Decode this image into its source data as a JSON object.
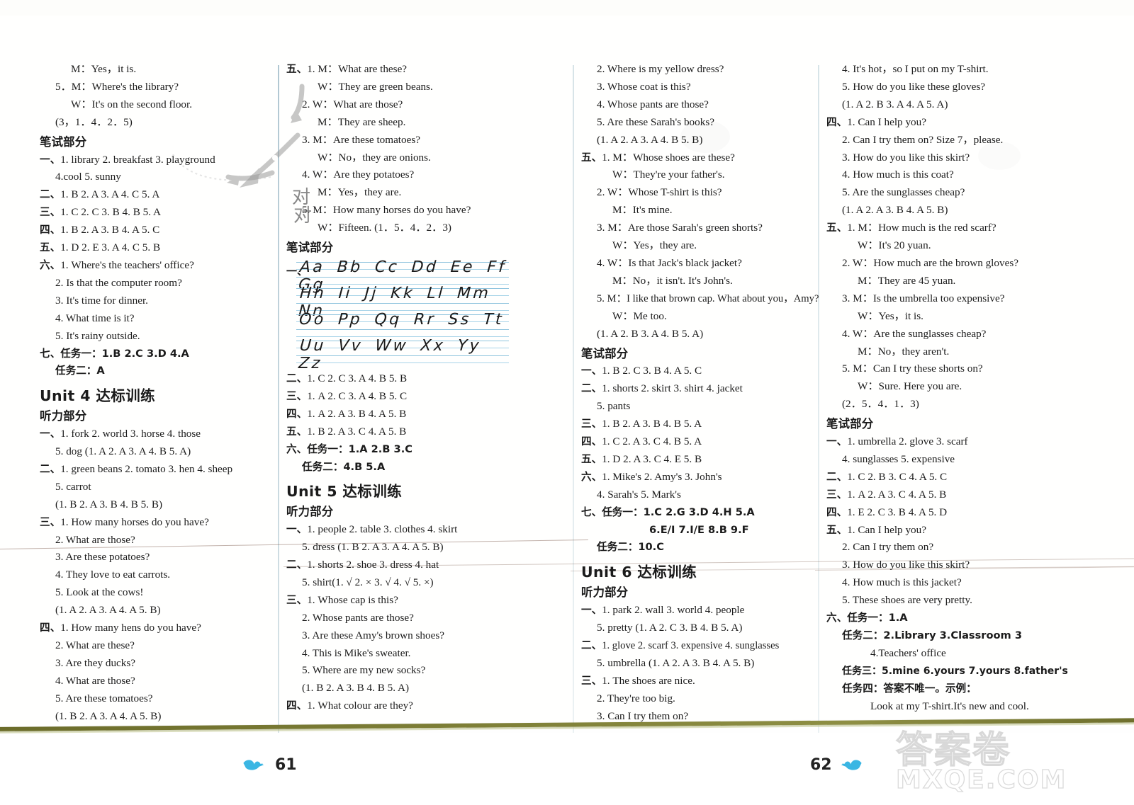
{
  "page": {
    "left_page_number": "61",
    "right_page_number": "62",
    "watermark_cn": "答案卷",
    "watermark_en": "MXQE.COM"
  },
  "labels": {
    "listening_section": "听力部分",
    "written_section": "笔试部分",
    "unit4_title": "Unit 4 达标训练",
    "unit5_title": "Unit 5 达标训练",
    "unit6_title": "Unit 6 达标训练"
  },
  "annotations": {
    "check_mark_1": "对",
    "check_mark_2": "对"
  },
  "col1": {
    "l01": "M：Yes，it is.",
    "l02": "5．M：Where's the library?",
    "l03": "W：It's on the second floor.",
    "l04": "(3，1．4．2．5)",
    "l05": "笔试部分",
    "l06_num": "一、",
    "l06": "1. library   2. breakfast   3. playground",
    "l07": "4.cool   5. sunny",
    "l08_num": "二、",
    "l08": "1. B   2. A   3. A   4. C   5. A",
    "l09_num": "三、",
    "l09": "1. C   2. C   3. B   4. B   5. A",
    "l10_num": "四、",
    "l10": "1. B   2. A   3. B   4. A   5. C",
    "l11_num": "五、",
    "l11": "1. D   2. E   3. A   4. C   5. B",
    "l12_num": "六、",
    "l12": "1. Where's the teachers' office?",
    "l13": "2. Is that the computer room?",
    "l14": "3. It's time for dinner.",
    "l15": "4. What time is it?",
    "l16": "5. It's rainy outside.",
    "l17_num": "七、",
    "l17": "任务一：1.B   2.C   3.D   4.A",
    "l18": "任务二：A",
    "unit_title": "Unit 4 达标训练",
    "listening": "听力部分",
    "l19_num": "一、",
    "l19": "1. fork   2. world   3. horse   4. those",
    "l20": "5. dog   (1. A   2. A   3. A   4. B   5. A)",
    "l21_num": "二、",
    "l21": "1. green beans   2. tomato   3. hen   4. sheep",
    "l22": "5. carrot",
    "l23": "(1. B   2. A   3. B   4. B   5. B)",
    "l24_num": "三、",
    "l24": "1. How many horses do you have?",
    "l25": "2. What are those?",
    "l26": "3. Are these potatoes?",
    "l27": "4. They love to eat carrots.",
    "l28": "5. Look at the cows!",
    "l29": "(1. A   2. A   3. A   4. A   5. B)",
    "l30_num": "四、",
    "l30": "1. How many hens do you have?",
    "l31": "2. What are these?",
    "l32": "3. Are they ducks?",
    "l33": "4. What are those?",
    "l34": "5. Are these tomatoes?",
    "l35": "(1. B   2. A   3. A   4. A   5. B)"
  },
  "col2": {
    "l01_num": "五、",
    "l01": "1. M：What are these?",
    "l02": "W：They are green beans.",
    "l03": "2. W：What are those?",
    "l04": "M：They are sheep.",
    "l05": "3. M：Are these tomatoes?",
    "l06": "W：No，they are onions.",
    "l07": "4. W：Are they potatoes?",
    "l08": "M：Yes，they are.",
    "l09": "5. M：How many horses do you have?",
    "l10": "W：Fifteen.   (1．5．4．2．3)",
    "l11": "笔试部分",
    "alphabet_rows": [
      "Aa Bb Cc Dd Ee Ff Gg",
      "Hh Ii Jj Kk Ll Mm Nn",
      "Oo Pp Qq Rr Ss Tt",
      "Uu Vv Ww Xx Yy Zz"
    ],
    "alphabet_num": "一、",
    "l12_num": "二、",
    "l12": "1. C   2. C   3. A   4. B   5. B",
    "l13_num": "三、",
    "l13": "1. A   2. C   3. A   4. B   5. C",
    "l14_num": "四、",
    "l14": "1. A   2. A   3. B   4. A   5. B",
    "l15_num": "五、",
    "l15": "1. B   2. A   3. C   4. A   5. B",
    "l16_num": "六、",
    "l16": "任务一：1.A   2.B   3.C",
    "l17": "任务二：4.B   5.A",
    "unit_title": "Unit 5 达标训练",
    "listening": "听力部分",
    "l18_num": "一、",
    "l18": "1. people   2. table   3. clothes   4. skirt",
    "l19": "5. dress   (1. B   2. A   3. A   4. A   5. B)",
    "l20_num": "二、",
    "l20": "1. shorts   2. shoe   3. dress   4. hat",
    "l21": "5. shirt(1. √   2. ×   3. √   4. √   5. ×)",
    "l22_num": "三、",
    "l22": "1. Whose cap is this?",
    "l23": "2. Whose pants are those?",
    "l24": "3. Are these Amy's brown shoes?",
    "l25": "4. This is Mike's sweater.",
    "l26": "5. Where are my new socks?",
    "l27": "(1. B   2. A   3. B   4. B   5. A)",
    "l28_num": "四、",
    "l28": "1. What colour are they?"
  },
  "col3": {
    "l01": "2. Where is my yellow dress?",
    "l02": "3. Whose coat is this?",
    "l03": "4. Whose pants are those?",
    "l04": "5. Are these Sarah's books?",
    "l05": "(1. A   2. A   3. A   4. B   5. B)",
    "l06_num": "五、",
    "l06": "1. M：Whose shoes are these?",
    "l07": "W：They're your father's.",
    "l08": "2. W：Whose T-shirt is this?",
    "l09": "M：It's mine.",
    "l10": "3. M：Are those Sarah's green shorts?",
    "l11": "W：Yes，they are.",
    "l12": "4. W：Is that Jack's black jacket?",
    "l13": "M：No，it isn't. It's John's.",
    "l14": "5. M：I like that brown cap. What about you，Amy?",
    "l15": "W：Me too.",
    "l16": "(1. A   2. B   3. A   4. B   5. A)",
    "l17": "笔试部分",
    "l18_num": "一、",
    "l18": "1. B   2. C   3. B   4. A   5. C",
    "l19_num": "二、",
    "l19": "1. shorts   2. skirt   3. shirt   4. jacket",
    "l20": "5. pants",
    "l21_num": "三、",
    "l21": "1. B   2. A   3. B   4. B   5. A",
    "l22_num": "四、",
    "l22": "1. C   2. A   3. C   4. B   5. A",
    "l23_num": "五、",
    "l23": "1. D   2. A   3. C   4. E   5. B",
    "l24_num": "六、",
    "l24": "1. Mike's   2. Amy's   3. John's",
    "l25": "4. Sarah's   5. Mark's",
    "l26_num": "七、",
    "l26": "任务一：1.C   2.G   3.D   4.H   5.A",
    "l27": "6.E/I   7.I/E   8.B   9.F",
    "l28": "任务二：10.C",
    "unit_title": "Unit 6 达标训练",
    "listening": "听力部分",
    "l29_num": "一、",
    "l29": "1. park   2. wall   3. world   4. people",
    "l30": "5. pretty   (1. A   2. C   3. B   4. B   5. A)",
    "l31_num": "二、",
    "l31": "1. glove   2. scarf   3. expensive   4. sunglasses",
    "l32": "5. umbrella   (1. A   2. A   3. B   4. A   5. B)",
    "l33_num": "三、",
    "l33": "1. The shoes are nice.",
    "l34": "2. They're too big.",
    "l35": "3. Can I try them on?"
  },
  "col4": {
    "l01": "4. It's hot，so I put on my T-shirt.",
    "l02": "5. How do you like these gloves?",
    "l03": "(1. A   2. B   3. A   4. A   5. A)",
    "l04_num": "四、",
    "l04": "1. Can I help you?",
    "l05": "2. Can I try them on? Size 7，please.",
    "l06": "3. How do you like this skirt?",
    "l07": "4. How much is this coat?",
    "l08": "5. Are the sunglasses cheap?",
    "l09": "(1. A   2. A   3. B   4. A   5. B)",
    "l10_num": "五、",
    "l10": "1. M：How much is the red scarf?",
    "l11": "W：It's 20 yuan.",
    "l12": "2. W：How much are the brown gloves?",
    "l13": "M：They are 45 yuan.",
    "l14": "3. M：Is the umbrella too expensive?",
    "l15": "W：Yes，it is.",
    "l16": "4. W：Are the sunglasses cheap?",
    "l17": "M：No，they aren't.",
    "l18": "5. M：Can I try these shorts on?",
    "l19": "W：Sure. Here you are.",
    "l20": "(2．5．4．1．3)",
    "l21": "笔试部分",
    "l22_num": "一、",
    "l22": "1. umbrella   2. glove   3. scarf",
    "l23": "4. sunglasses   5. expensive",
    "l24_num": "二、",
    "l24": "1. C   2. B   3. C   4. A   5. C",
    "l25_num": "三、",
    "l25": "1. A   2. A   3. C   4. A   5. B",
    "l26_num": "四、",
    "l26": "1. E   2. C   3. B   4. A   5. D",
    "l27_num": "五、",
    "l27": "1. Can I help you?",
    "l28": "2. Can I try them on?",
    "l29": "3. How do you like this skirt?",
    "l30": "4. How much is this jacket?",
    "l31": "5. These shoes are very pretty.",
    "l32_num": "六、",
    "l32": "任务一：1.A",
    "l33": "任务二：2.Library   3.Classroom 3",
    "l34": "4.Teachers' office",
    "l35": "任务三：5.mine   6.yours   7.yours   8.father's",
    "l36": "任务四：答案不唯一。示例：",
    "l37": "Look at my T-shirt.It's new and cool."
  }
}
